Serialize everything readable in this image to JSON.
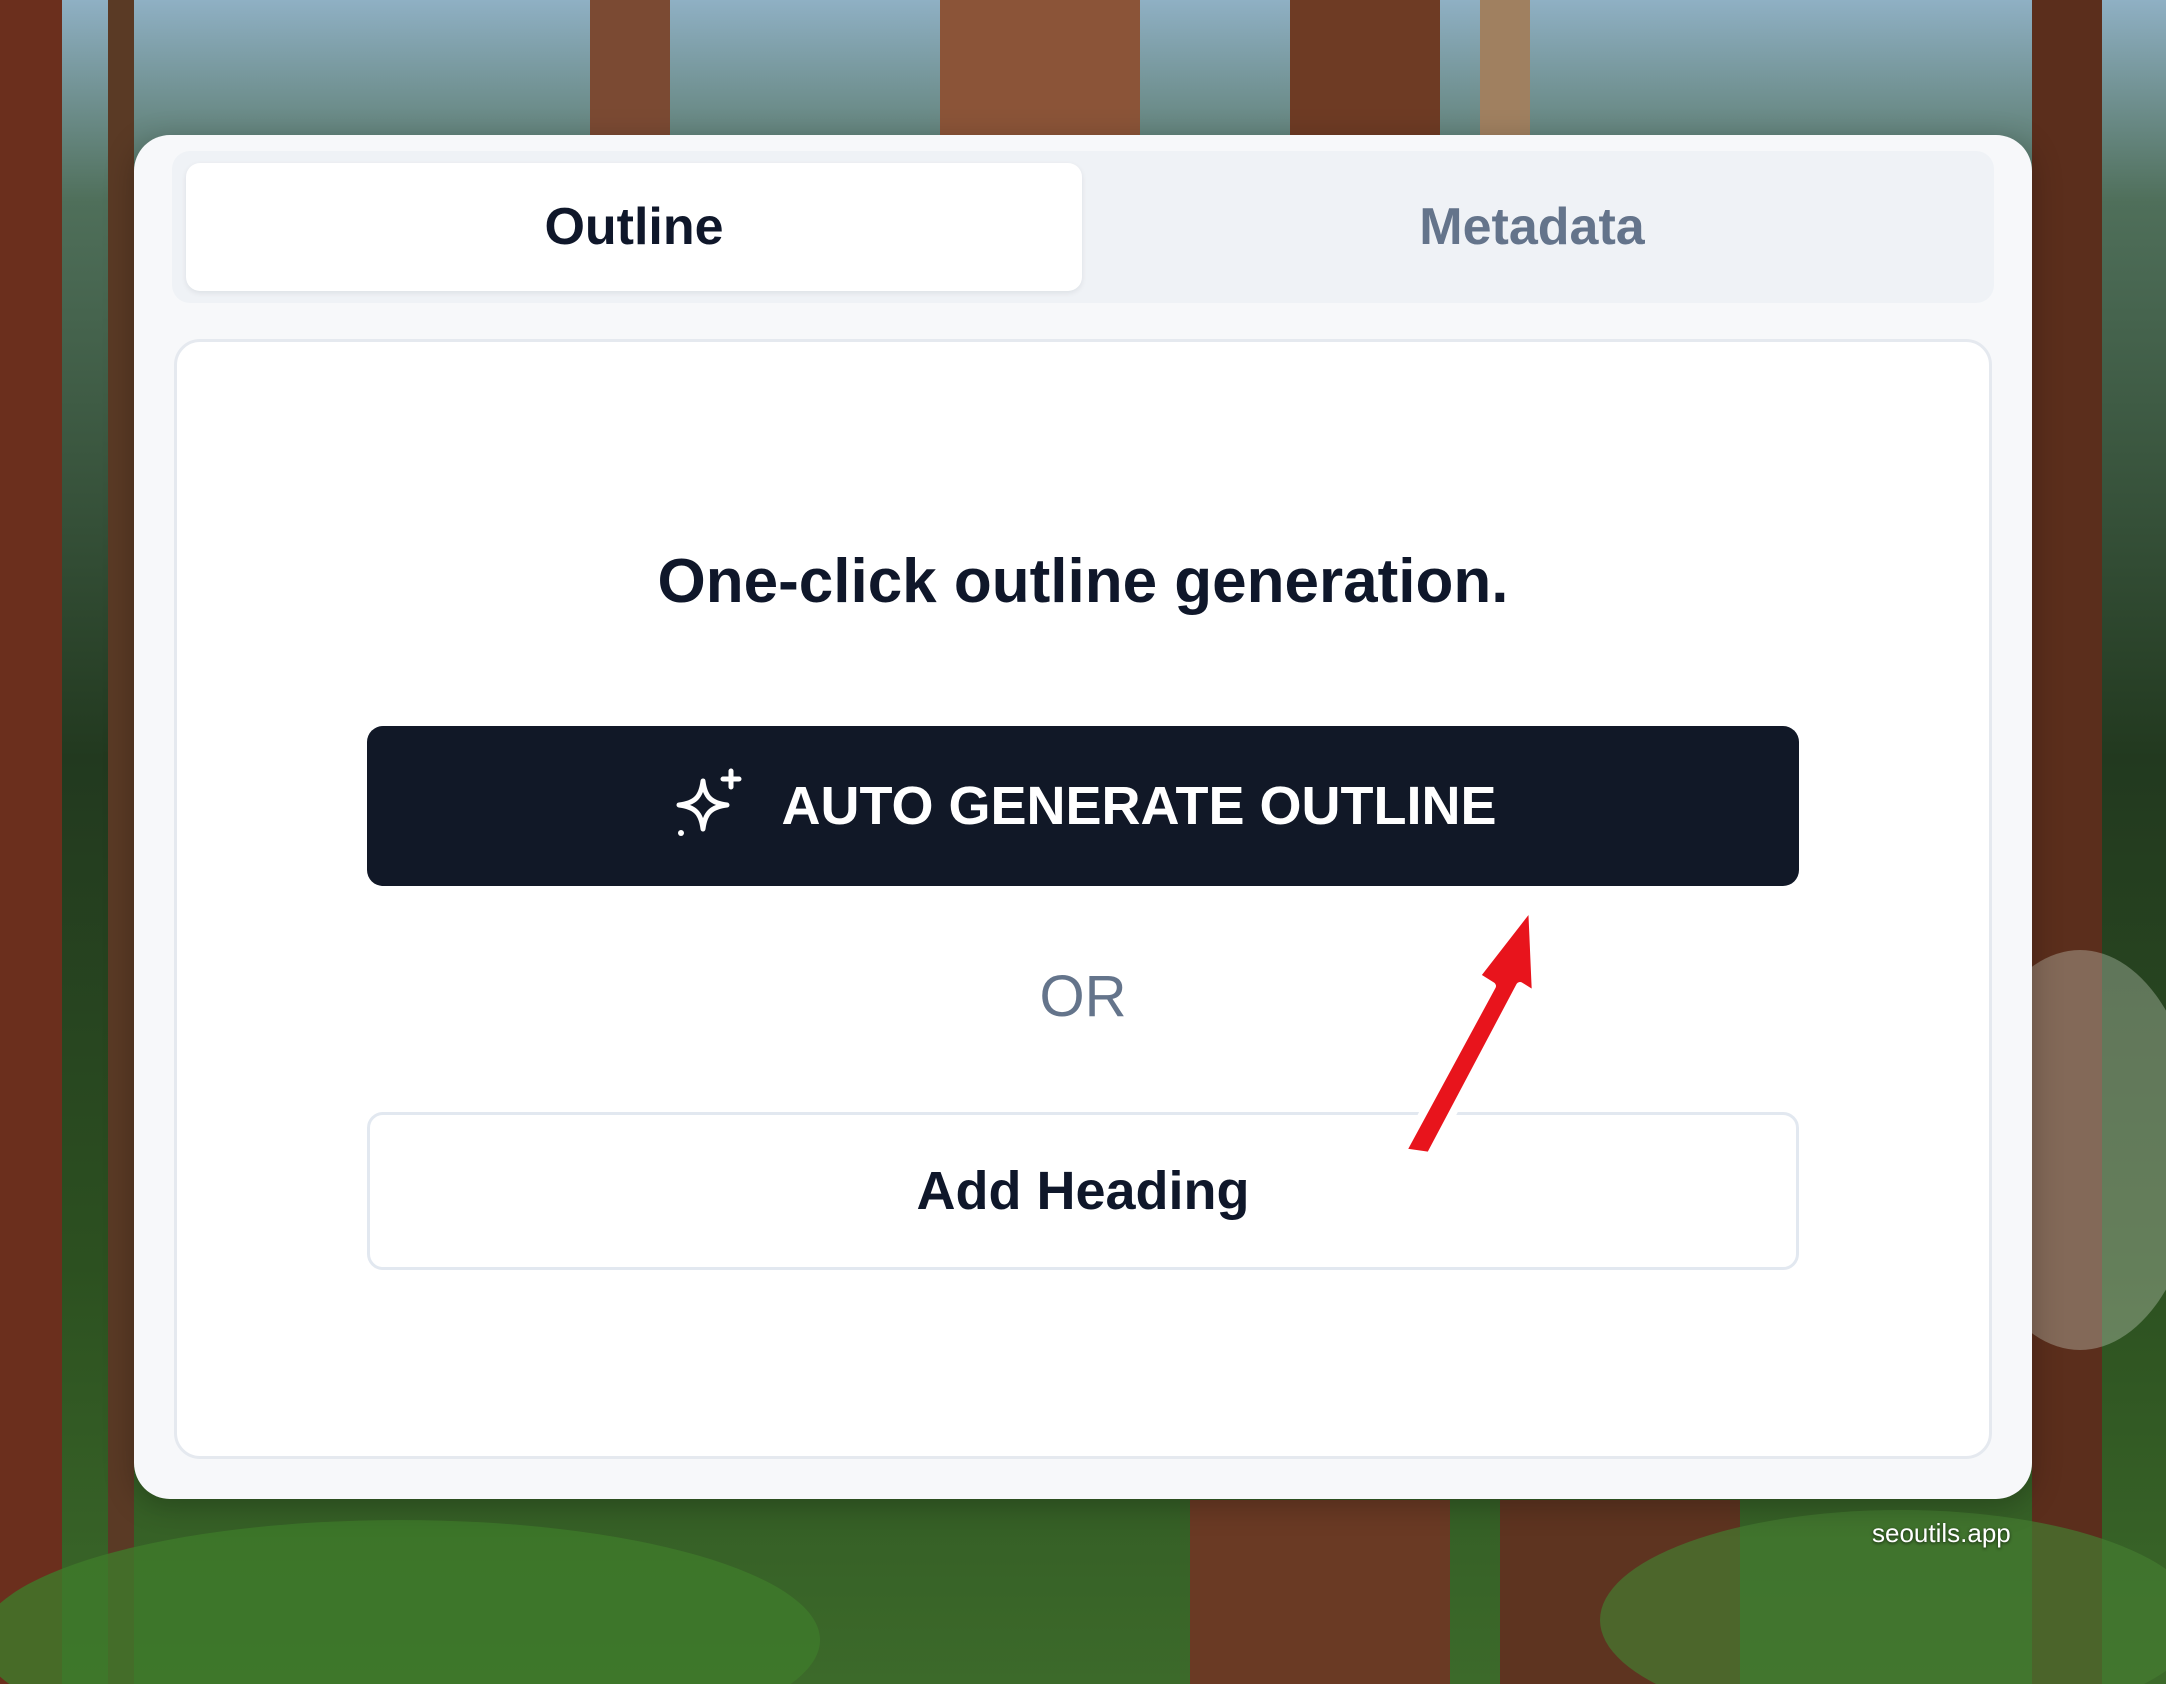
{
  "tabs": [
    {
      "label": "Outline",
      "active": true
    },
    {
      "label": "Metadata",
      "active": false
    }
  ],
  "panel": {
    "headline": "One-click outline generation.",
    "primary_button": {
      "label": "AUTO GENERATE OUTLINE",
      "icon": "sparkles-icon"
    },
    "divider_text": "OR",
    "secondary_button": {
      "label": "Add Heading"
    }
  },
  "annotation": {
    "type": "red-arrow",
    "points_to": "AUTO GENERATE OUTLINE",
    "color": "#e8141c"
  },
  "watermark": "seoutils.app",
  "colors": {
    "primary_button_bg": "#111827",
    "active_tab_text": "#0f172a",
    "inactive_tab_text": "#64748b"
  }
}
